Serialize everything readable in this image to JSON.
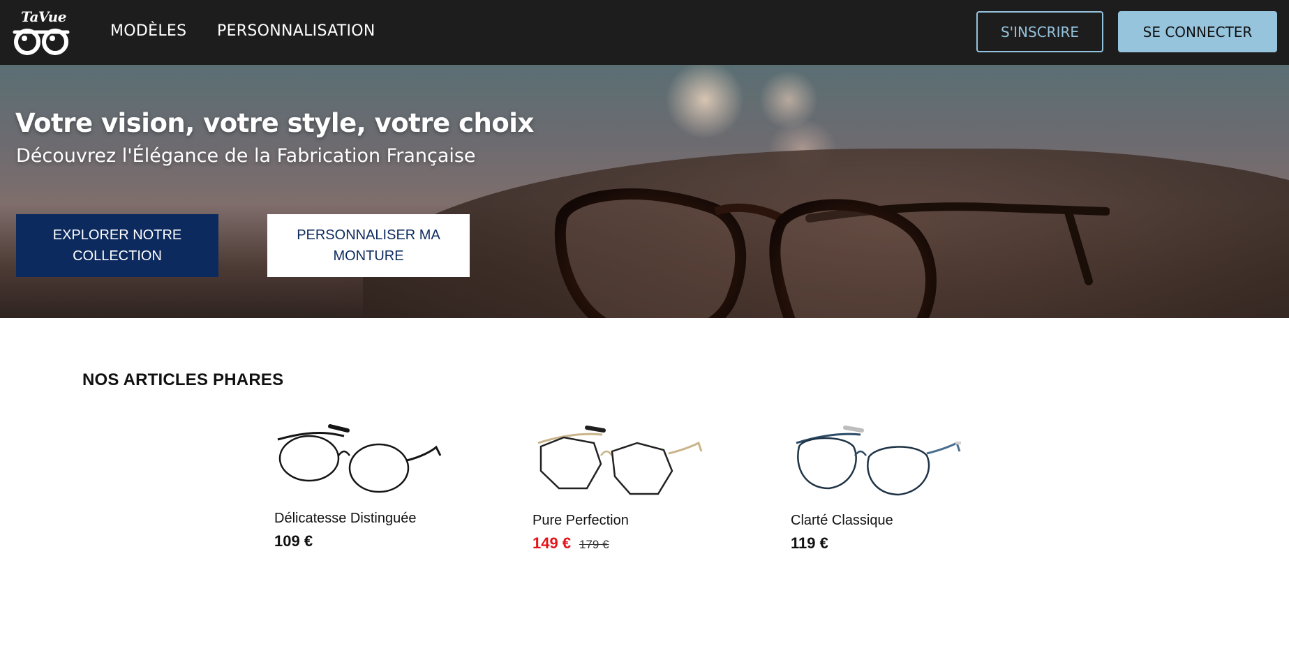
{
  "header": {
    "logo_text": "TaVue",
    "nav": [
      {
        "label": "MODÈLES"
      },
      {
        "label": "PERSONNALISATION"
      }
    ],
    "signup_label": "S'INSCRIRE",
    "login_label": "SE CONNECTER"
  },
  "hero": {
    "title": "Votre vision, votre style, votre choix",
    "subtitle": "Découvrez l'Élégance de la Fabrication Française",
    "explore_label": "EXPLORER NOTRE COLLECTION",
    "customize_label": "PERSONNALISER MA MONTURE"
  },
  "featured": {
    "title": "NOS ARTICLES PHARES",
    "products": [
      {
        "name": "Délicatesse Distinguée",
        "price": "109 €",
        "old_price": "",
        "icon": "round-black-glasses-icon"
      },
      {
        "name": "Pure Perfection",
        "price": "149 €",
        "old_price": "179 €",
        "icon": "hexagonal-gold-glasses-icon"
      },
      {
        "name": "Clarté Classique",
        "price": "119 €",
        "old_price": "",
        "icon": "round-blue-glasses-icon"
      }
    ]
  },
  "colors": {
    "header_bg": "#1d1d1d",
    "accent": "#96c4dd",
    "navy": "#0c2a5e",
    "sale": "#e4141b"
  }
}
